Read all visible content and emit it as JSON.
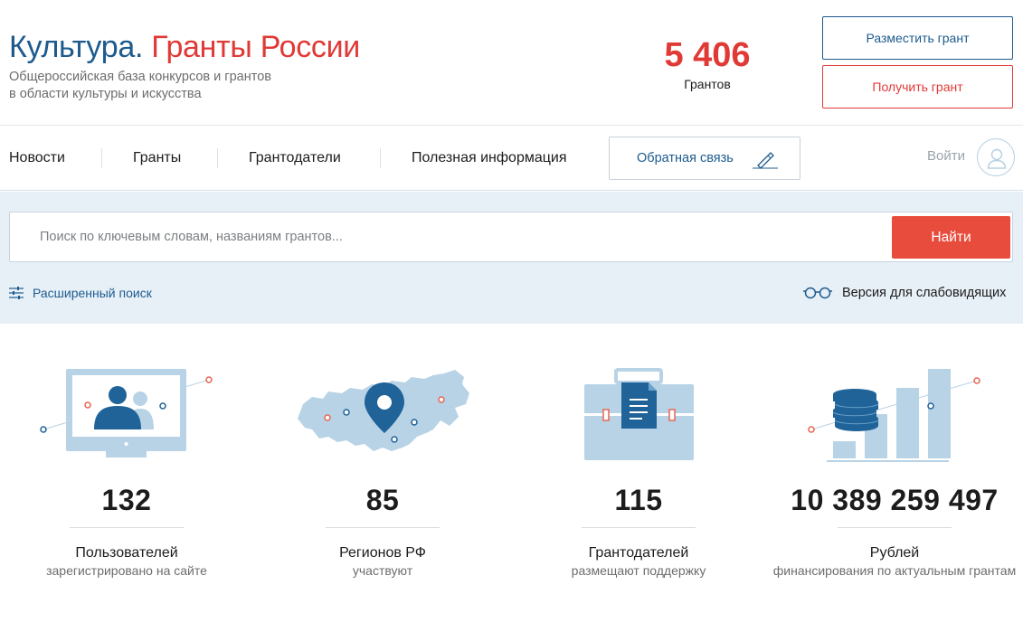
{
  "header": {
    "brand_part1": "Культура.",
    "brand_part2": "Гранты России",
    "subtitle_line1": "Общероссийская база конкурсов и грантов",
    "subtitle_line2": "в области культуры и искусства",
    "counter_value": "5 406",
    "counter_label": "Грантов",
    "post_grant_label": "Разместить грант",
    "get_grant_label": "Получить грант"
  },
  "nav": {
    "items": [
      {
        "label": "Новости"
      },
      {
        "label": "Гранты"
      },
      {
        "label": "Грантодатели"
      },
      {
        "label": "Полезная информация"
      }
    ],
    "feedback_label": "Обратная связь",
    "login_label": "Войти"
  },
  "search": {
    "placeholder": "Поиск по ключевым словам, названиям грантов...",
    "button_label": "Найти",
    "advanced_label": "Расширенный поиск",
    "accessibility_label": "Версия для слабовидящих"
  },
  "stats": [
    {
      "value": "132",
      "title": "Пользователей",
      "desc": "зарегистрировано на сайте",
      "icon": "users-monitor-icon"
    },
    {
      "value": "85",
      "title": "Регионов РФ",
      "desc": "участвуют",
      "icon": "russia-map-pin-icon"
    },
    {
      "value": "115",
      "title": "Грантодателей",
      "desc": "размещают поддержку",
      "icon": "briefcase-document-icon"
    },
    {
      "value": "10 389 259 497",
      "title": "Рублей",
      "desc": "финансирования по актуальным грантам",
      "icon": "coins-chart-icon"
    }
  ],
  "colors": {
    "brand_blue": "#1d5b8e",
    "brand_red": "#e03a37",
    "search_button": "#e84c3d",
    "band_background": "#e7f0f7",
    "illustration_light_blue": "#b8d3e6",
    "illustration_dark_blue": "#1f6399"
  }
}
